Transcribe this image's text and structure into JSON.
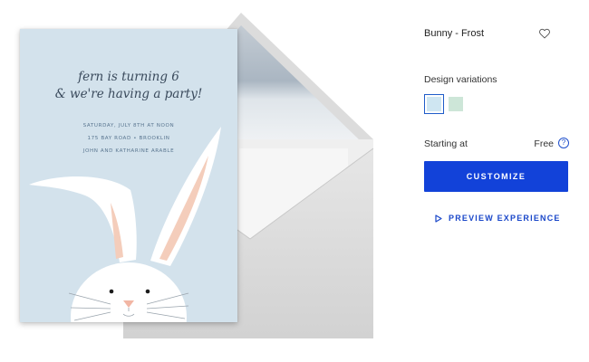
{
  "product": {
    "title": "Bunny - Frost",
    "favorite_icon": "heart-outline-icon"
  },
  "card": {
    "script_lines": [
      "fern is turning 6",
      "& we're having a party!"
    ],
    "detail_lines": [
      "SATURDAY, JULY 8TH AT NOON",
      "175 BAY ROAD • BROOKLIN",
      "JOHN AND KATHARINE ARABLE"
    ],
    "background_color": "#d3e2ec"
  },
  "variations": {
    "label": "Design variations",
    "swatches": [
      {
        "color": "#cfe6f2",
        "selected": true
      },
      {
        "color": "#cde6d8",
        "selected": false
      }
    ]
  },
  "pricing": {
    "label": "Starting at",
    "value": "Free",
    "help_icon": "question-circle-icon"
  },
  "actions": {
    "customize_label": "CUSTOMIZE",
    "preview_label": "PREVIEW EXPERIENCE",
    "preview_icon": "play-outline-icon"
  },
  "colors": {
    "accent": "#1242d9",
    "link": "#1a47c9"
  }
}
